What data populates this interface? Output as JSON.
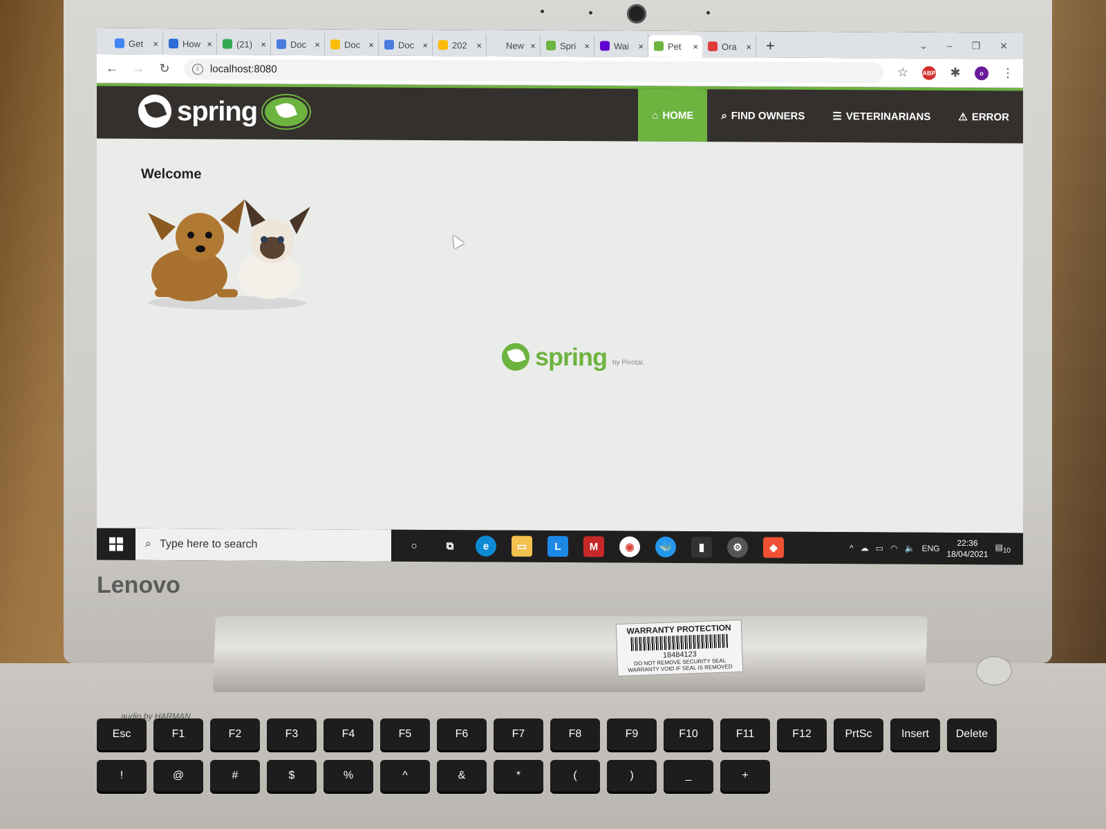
{
  "browser": {
    "tabs": [
      {
        "title": "Get",
        "color": "#4285f4"
      },
      {
        "title": "How",
        "color": "#2b6cd4"
      },
      {
        "title": "(21)",
        "color": "#33a852"
      },
      {
        "title": "Doc",
        "color": "#4a7ce0"
      },
      {
        "title": "Doc",
        "color": "#fbbc04"
      },
      {
        "title": "Doc",
        "color": "#4a7ce0"
      },
      {
        "title": "202",
        "color": "#fbbc04"
      },
      {
        "title": "New Tal",
        "color": "#dee1e6"
      },
      {
        "title": "Spri",
        "color": "#6db33f"
      },
      {
        "title": "Wai",
        "color": "#5f01d1"
      },
      {
        "title": "Pet",
        "color": "#6db33f"
      },
      {
        "title": "Ora",
        "color": "#e03b3b"
      }
    ],
    "active_tab_index": 10,
    "url": "localhost:8080",
    "new_tab_label": "+",
    "profile_initial": "o"
  },
  "app": {
    "brand": "spring",
    "menu": [
      {
        "label": "HOME",
        "icon": "home-icon",
        "active": true
      },
      {
        "label": "FIND OWNERS",
        "icon": "search-icon",
        "active": false
      },
      {
        "label": "VETERINARIANS",
        "icon": "list-icon",
        "active": false
      },
      {
        "label": "ERROR",
        "icon": "warning-icon",
        "active": false
      }
    ],
    "heading": "Welcome",
    "footer_logo": "spring",
    "footer_by": "by Pivotal."
  },
  "taskbar": {
    "search_placeholder": "Type here to search",
    "language": "ENG",
    "time": "22:36",
    "date": "18/04/2021",
    "notifications": "10"
  },
  "device": {
    "brand": "Lenovo",
    "audio": "audio by HARMAN",
    "sticker_title": "WARRANTY PROTECTION",
    "sticker_number": "18484123",
    "sticker_line1": "DO NOT REMOVE SECURITY SEAL",
    "sticker_line2": "WARRANTY VOID IF SEAL IS REMOVED"
  },
  "keyboard": {
    "row1": [
      "Esc",
      "F1",
      "F2",
      "F3",
      "F4",
      "F5",
      "F6",
      "F7",
      "F8",
      "F9",
      "F10",
      "F11",
      "F12",
      "PrtSc",
      "Insert",
      "Delete"
    ],
    "row2": [
      "!",
      "@",
      "#",
      "$",
      "%",
      "^",
      "&",
      "*",
      "(",
      ")",
      "_",
      "+"
    ]
  },
  "colors": {
    "spring_green": "#6db33f",
    "navbar": "#34302d",
    "taskbar": "#1f1f1f"
  }
}
